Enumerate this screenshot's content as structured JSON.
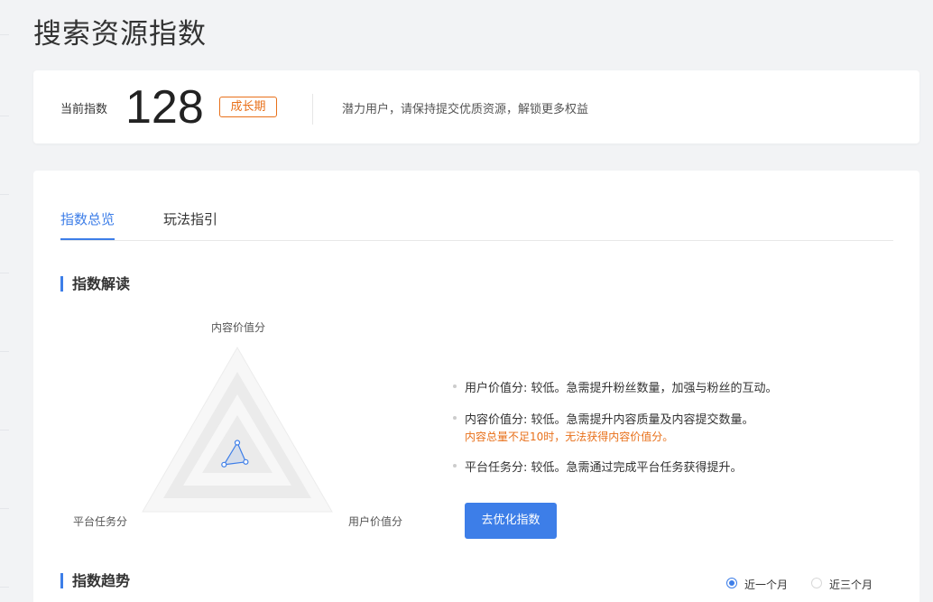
{
  "page": {
    "title": "搜索资源指数"
  },
  "summary": {
    "index_label": "当前指数",
    "index_value": "128",
    "stage_badge": "成长期",
    "description": "潜力用户，请保持提交优质资源，解锁更多权益"
  },
  "tabs": [
    {
      "label": "指数总览",
      "active": true
    },
    {
      "label": "玩法指引",
      "active": false
    }
  ],
  "interpretation": {
    "section_title": "指数解读",
    "radar": {
      "axes": [
        "内容价值分",
        "用户价值分",
        "平台任务分"
      ],
      "values": [
        0.13,
        0.09,
        0.14
      ]
    },
    "items": [
      {
        "text": "用户价值分: 较低。急需提升粉丝数量，加强与粉丝的互动。"
      },
      {
        "text": "内容价值分: 较低。急需提升内容质量及内容提交数量。",
        "warning": "内容总量不足10时，无法获得内容价值分。"
      },
      {
        "text": "平台任务分: 较低。急需通过完成平台任务获得提升。"
      }
    ],
    "optimize_button": "去优化指数"
  },
  "trend": {
    "section_title": "指数趋势",
    "range_options": [
      {
        "label": "近一个月",
        "selected": true
      },
      {
        "label": "近三个月",
        "selected": false
      }
    ]
  },
  "colors": {
    "accent": "#3d7ee8",
    "warning": "#e8701a"
  }
}
